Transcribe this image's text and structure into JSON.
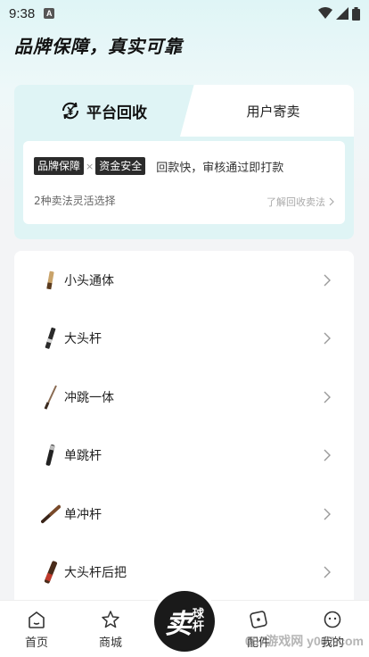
{
  "status_bar": {
    "time": "9:38",
    "notif_letter": "A"
  },
  "hero": {
    "title": "品牌保障，真实可靠"
  },
  "card": {
    "tab_active": "平台回收",
    "tab_inactive": "用户寄卖",
    "badge1": "品牌保障",
    "badge_sep": "×",
    "badge2": "资金安全",
    "desc": "回款快，审核通过即打款",
    "sub": "2种卖法灵活选择",
    "link": "了解回收卖法"
  },
  "list": {
    "items": [
      {
        "label": "小头通体",
        "icon": "cue-small-head-icon"
      },
      {
        "label": "大头杆",
        "icon": "cue-big-head-icon"
      },
      {
        "label": "冲跳一体",
        "icon": "cue-jump-break-icon"
      },
      {
        "label": "单跳杆",
        "icon": "cue-jump-icon"
      },
      {
        "label": "单冲杆",
        "icon": "cue-break-icon"
      },
      {
        "label": "大头杆后把",
        "icon": "cue-butt-icon"
      }
    ]
  },
  "tabbar": {
    "home": "首页",
    "mall": "商城",
    "center_big": "卖",
    "center_small_1": "球",
    "center_small_2": "杆",
    "parts": "配件",
    "mine": "我的"
  },
  "watermark": "007游戏网 y007.com",
  "colors": {
    "accent_bg": "#dff4f5",
    "badge_bg": "#2b2b2b",
    "center_btn": "#1a1a1a"
  }
}
